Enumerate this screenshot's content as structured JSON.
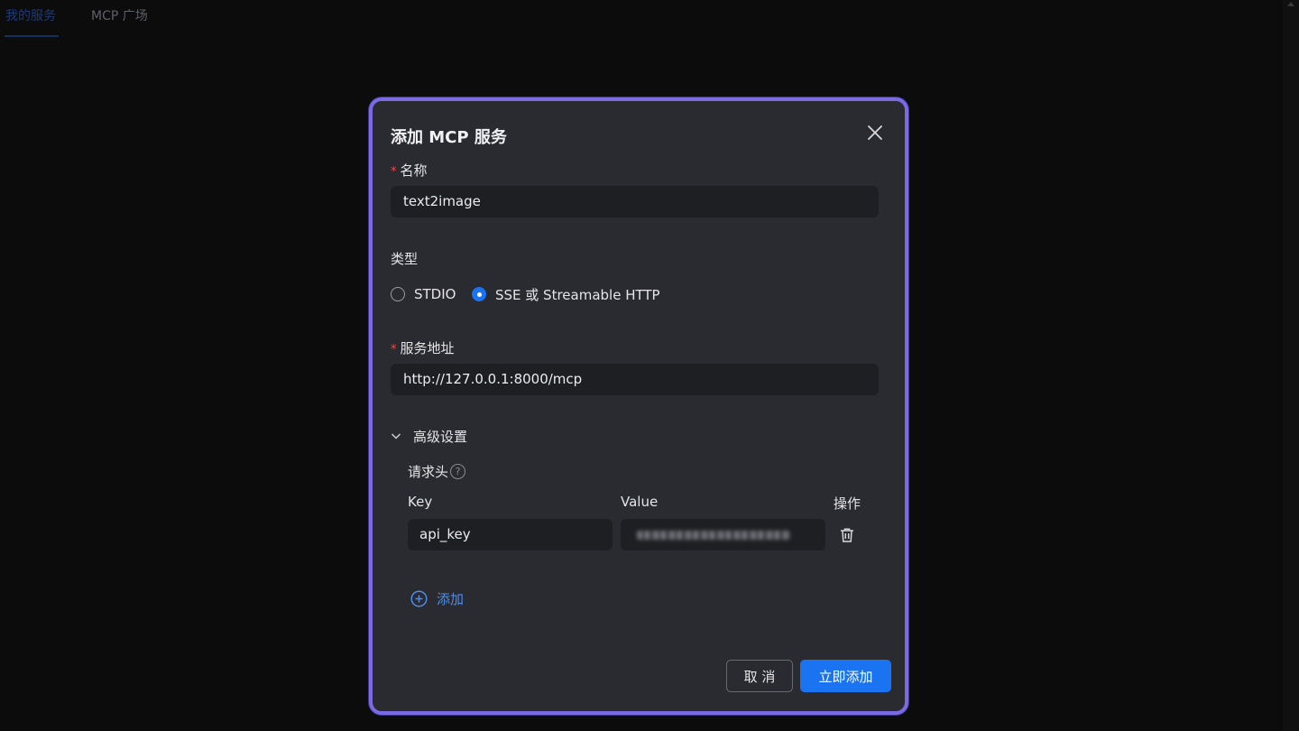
{
  "tabs": [
    {
      "label": "我的服务",
      "active": true
    },
    {
      "label": "MCP 广场",
      "active": false
    }
  ],
  "modal": {
    "title": "添加 MCP 服务",
    "name_label": "名称",
    "name_value": "text2image",
    "type_label": "类型",
    "type_options": [
      {
        "label": "STDIO",
        "checked": false
      },
      {
        "label": "SSE 或 Streamable HTTP",
        "checked": true
      }
    ],
    "url_label": "服务地址",
    "url_value": "http://127.0.0.1:8000/mcp",
    "advanced_label": "高级设置",
    "headers_label": "请求头",
    "help_glyph": "?",
    "columns": {
      "key": "Key",
      "value": "Value",
      "action": "操作"
    },
    "header_row": {
      "key": "api_key"
    },
    "add_label": "添加",
    "cancel_label": "取 消",
    "submit_label": "立即添加"
  },
  "colors": {
    "accent": "#1a73f0",
    "modal_border": "#7a6ae3",
    "required": "#f5484a",
    "link": "#4f8de9"
  },
  "icons": [
    "close-icon",
    "chevron-down-icon",
    "help-icon",
    "trash-icon",
    "add-circle-icon"
  ]
}
